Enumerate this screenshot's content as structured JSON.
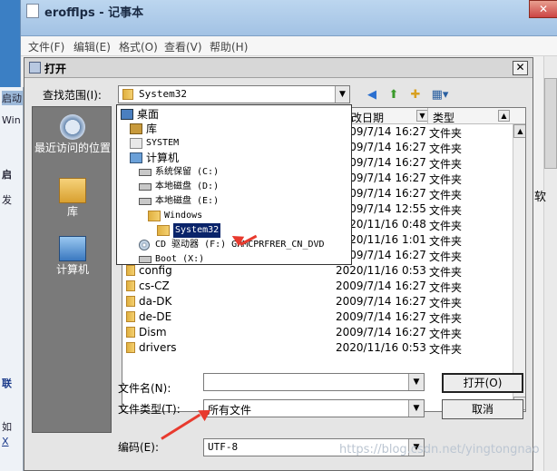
{
  "notepad": {
    "title": "erofflps - 记事本",
    "menu": [
      "文件(F)",
      "编辑(E)",
      "格式(O)",
      "查看(V)",
      "帮助(H)"
    ],
    "close": "✕"
  },
  "behind_left": [
    "启动",
    "Win",
    "启",
    "发",
    "联",
    "如",
    "X"
  ],
  "behind_right": [
    "软"
  ],
  "dialog": {
    "title": "打开",
    "close": "✕",
    "look_in_label": "查找范围(I):",
    "look_in_value": "System32",
    "places": [
      {
        "label": "最近访问的位置"
      },
      {
        "label": "库"
      },
      {
        "label": "计算机"
      }
    ],
    "columns": {
      "date": "修改日期",
      "type": "类型"
    },
    "rows": [
      {
        "name": "",
        "date": "2009/7/14 16:27",
        "type": "文件夹"
      },
      {
        "name": "",
        "date": "2009/7/14 16:27",
        "type": "文件夹"
      },
      {
        "name": "",
        "date": "2009/7/14 16:27",
        "type": "文件夹"
      },
      {
        "name": "",
        "date": "2009/7/14 16:27",
        "type": "文件夹"
      },
      {
        "name": "",
        "date": "2009/7/14 16:27",
        "type": "文件夹"
      },
      {
        "name": "",
        "date": "2009/7/14 12:55",
        "type": "文件夹"
      },
      {
        "name": "",
        "date": "2020/11/16 0:48",
        "type": "文件夹"
      },
      {
        "name": "",
        "date": "2020/11/16 1:01",
        "type": "文件夹"
      },
      {
        "name": "",
        "date": "2009/7/14 16:27",
        "type": "文件夹"
      },
      {
        "name": "config",
        "date": "2020/11/16 0:53",
        "type": "文件夹"
      },
      {
        "name": "cs-CZ",
        "date": "2009/7/14 16:27",
        "type": "文件夹"
      },
      {
        "name": "da-DK",
        "date": "2009/7/14 16:27",
        "type": "文件夹"
      },
      {
        "name": "de-DE",
        "date": "2009/7/14 16:27",
        "type": "文件夹"
      },
      {
        "name": "Dism",
        "date": "2009/7/14 16:27",
        "type": "文件夹"
      },
      {
        "name": "drivers",
        "date": "2020/11/16 0:53",
        "type": "文件夹"
      }
    ],
    "dropdown": [
      {
        "label": "桌面",
        "icon": "desktop-icon"
      },
      {
        "label": "库",
        "icon": "library-icon"
      },
      {
        "label": "SYSTEM",
        "icon": "user-folder-icon"
      },
      {
        "label": "计算机",
        "icon": "computer-icon"
      },
      {
        "label": "系统保留 (C:)",
        "icon": "drive-icon"
      },
      {
        "label": "本地磁盘 (D:)",
        "icon": "drive-icon"
      },
      {
        "label": "本地磁盘 (E:)",
        "icon": "drive-icon"
      },
      {
        "label": "Windows",
        "icon": "folder-icon"
      },
      {
        "label": "System32",
        "icon": "folder-icon"
      },
      {
        "label": "CD 驱动器 (F:) GRMCPRFRER_CN_DVD",
        "icon": "cd-drive-icon"
      },
      {
        "label": "Boot (X:)",
        "icon": "drive-icon"
      }
    ],
    "filename_label": "文件名(N):",
    "filename_value": "",
    "filetype_label": "文件类型(T):",
    "filetype_value": "所有文件",
    "encoding_label": "编码(E):",
    "encoding_value": "UTF-8",
    "open_button": "打开(O)",
    "cancel_button": "取消"
  },
  "watermark": "https://blog.csdn.net/yingtongnao",
  "colors": {
    "selection": "#0a246a",
    "annotation_arrow": "#e83a2e",
    "places_bar": "#7a7a7a"
  }
}
